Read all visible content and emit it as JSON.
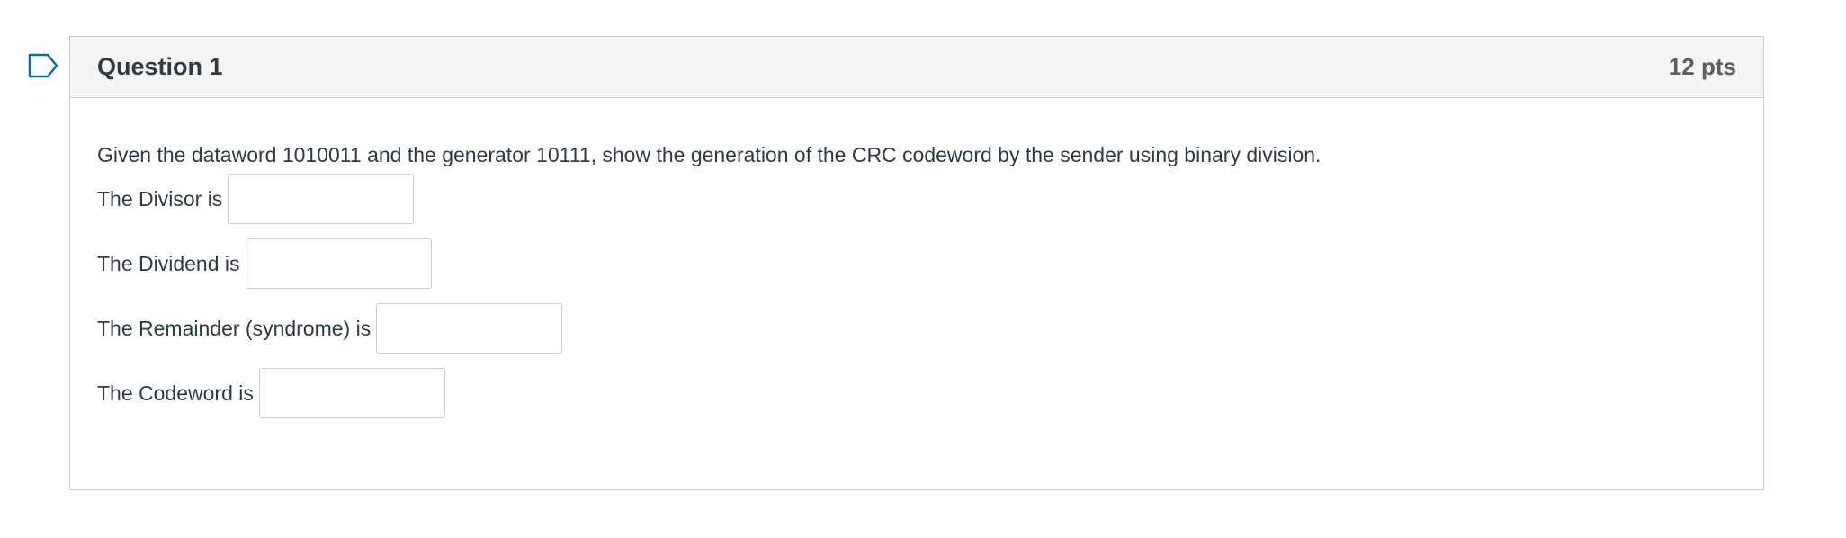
{
  "question": {
    "title": "Question 1",
    "points": "12 pts",
    "prompt": "Given the dataword 1010011 and the generator 10111,  show the generation of the CRC codeword by the sender using binary division.",
    "blanks": [
      {
        "label": "The Divisor is",
        "value": ""
      },
      {
        "label": "The Dividend is",
        "value": ""
      },
      {
        "label": "The Remainder (syndrome) is",
        "value": ""
      },
      {
        "label": "The Codeword is",
        "value": ""
      }
    ]
  },
  "icons": {
    "flag": "bookmark-flag-icon"
  },
  "colors": {
    "flag_outline": "#0770a3",
    "header_bg": "#f5f5f5",
    "border": "#c7cdd1",
    "text": "#2d3b45"
  }
}
